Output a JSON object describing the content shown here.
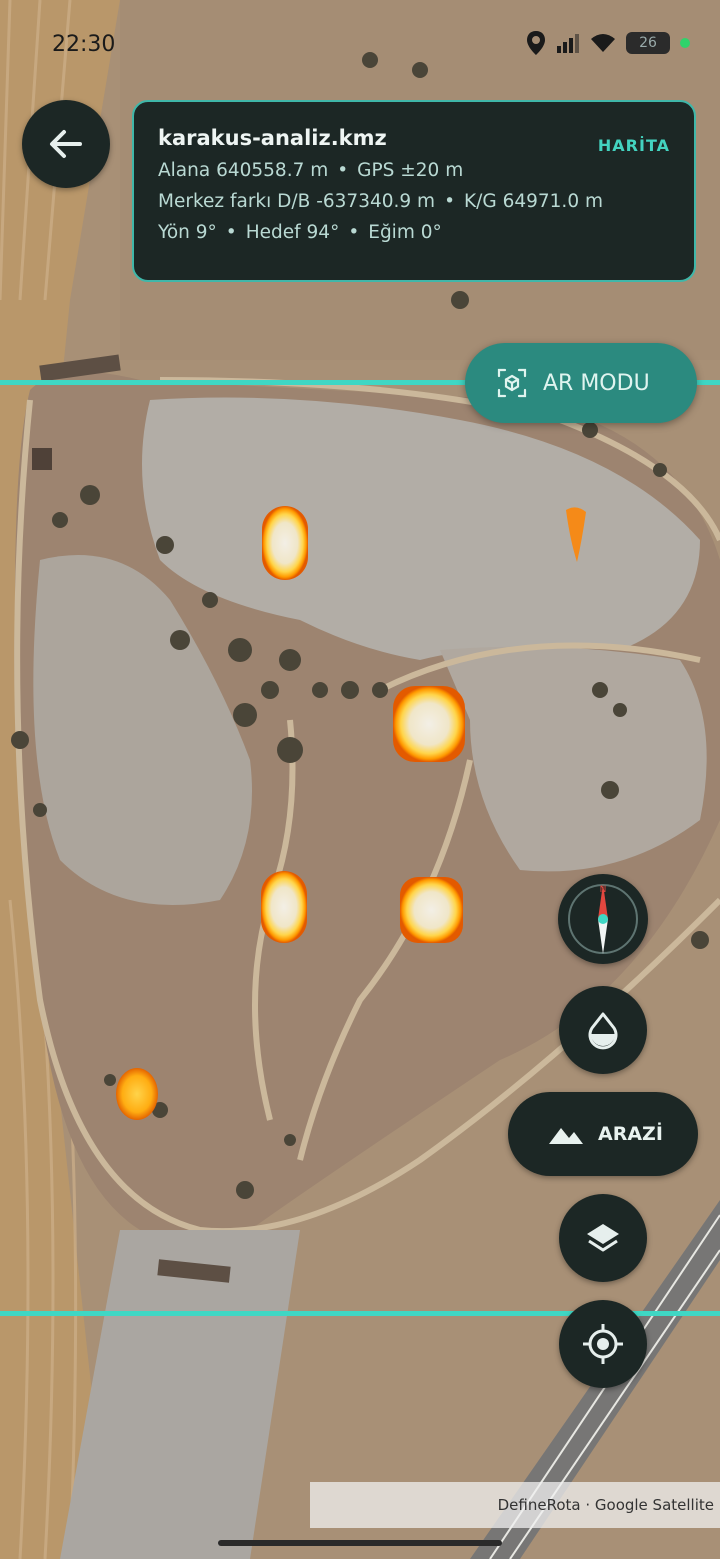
{
  "status_bar": {
    "time": "22:30",
    "battery": "26"
  },
  "info_card": {
    "file_name": "karakus-analiz.kmz",
    "mode_label": "HARİTA",
    "area_label": "Alana 640558.7 m",
    "gps_label": "GPS ±20 m",
    "center_diff_label": "Merkez farkı D/B -637340.9 m",
    "ns_label": "K/G 64971.0 m",
    "heading_label": "Yön 9°",
    "target_label": "Hedef 94°",
    "slope_label": "Eğim 0°",
    "separator": "•"
  },
  "ar_button": {
    "label": "AR MODU"
  },
  "terrain_button": {
    "label": "ARAZİ"
  },
  "attribution": {
    "text": "DefineRota · Google Satellite"
  },
  "icons": {
    "back": "arrow-left-icon",
    "ar": "ar-cube-icon",
    "compass": "compass-icon",
    "drop": "water-drop-icon",
    "terrain": "mountain-icon",
    "layers": "layers-icon",
    "locate": "crosshair-icon"
  },
  "colors": {
    "accent": "#3fd7c4",
    "panel": "#1c2725",
    "hotspot": "#ffb000"
  }
}
